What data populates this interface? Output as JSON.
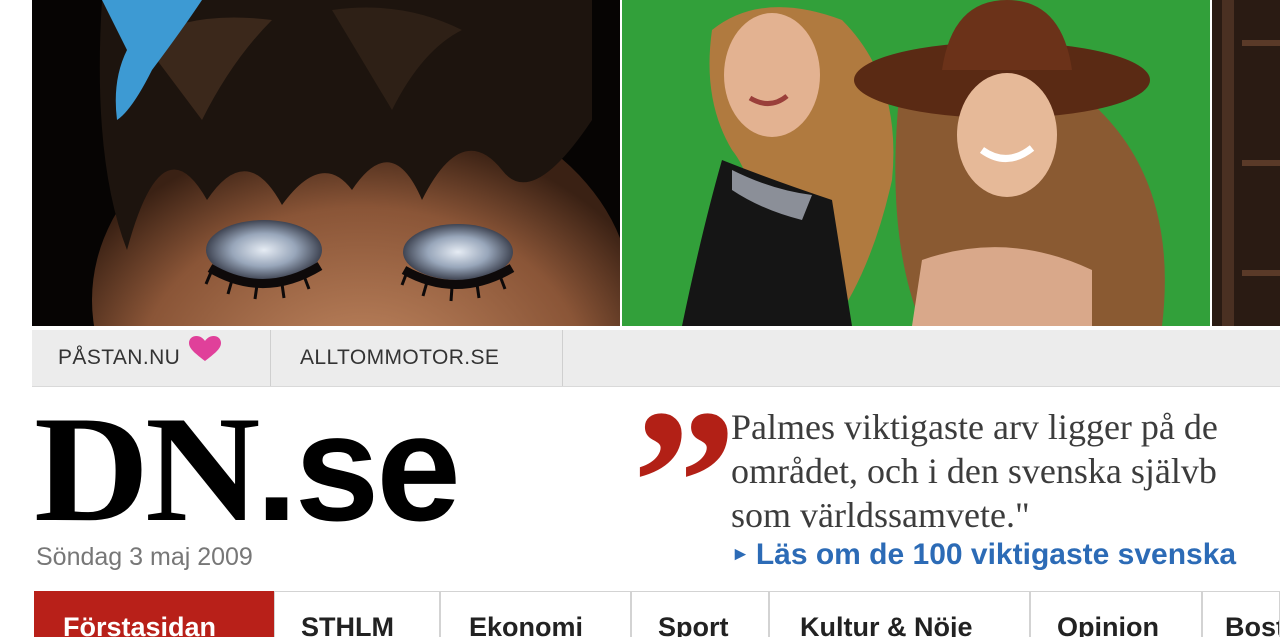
{
  "partners": {
    "links": [
      {
        "label": "PÅSTAN.NU",
        "icon": "heart-icon"
      },
      {
        "label": "ALLTOMMOTOR.SE"
      }
    ],
    "heart_color": "#e0409a"
  },
  "logo": {
    "dn": "DN",
    "se": ".se"
  },
  "date": "Söndag 3 maj 2009",
  "quote": {
    "mark": "”",
    "lines": [
      "Palmes viktigaste arv ligger på de",
      "området, och i den svenska självb",
      "som världssamvete.\""
    ],
    "link_label": "Läs om de 100 viktigaste svenska",
    "link_icon": "arrow-right-icon"
  },
  "nav": {
    "tabs": [
      {
        "label": "Förstasidan",
        "active": true
      },
      {
        "label": "STHLM"
      },
      {
        "label": "Ekonomi"
      },
      {
        "label": "Sport"
      },
      {
        "label": "Kultur & Nöje"
      },
      {
        "label": "Opinion"
      },
      {
        "label": "Bostad"
      }
    ]
  },
  "colors": {
    "accent_red": "#b82019",
    "link_blue": "#2c6bb6",
    "quote_red": "#b22016"
  }
}
